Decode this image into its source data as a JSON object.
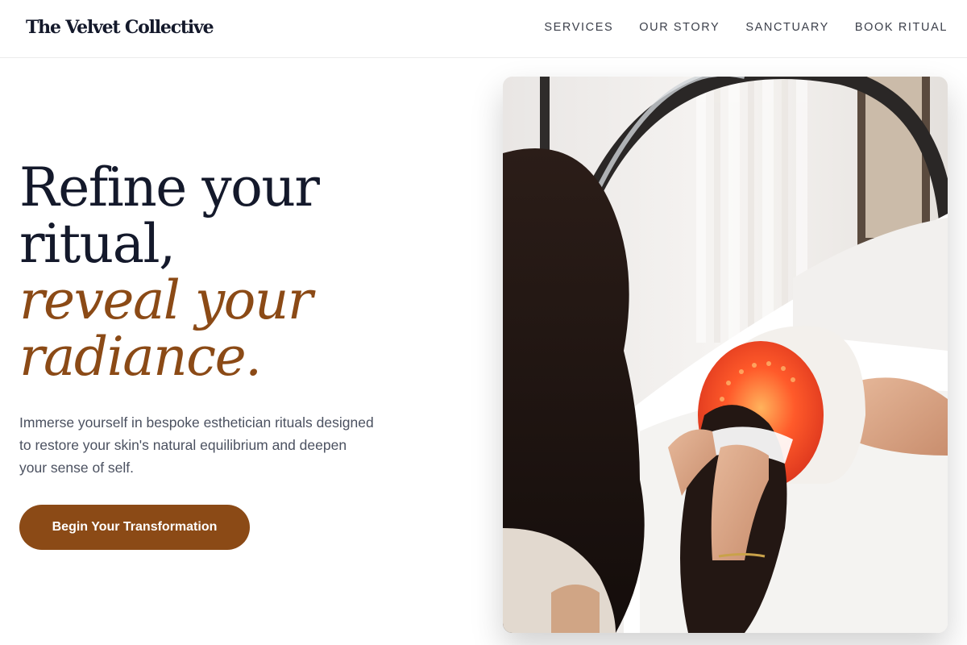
{
  "header": {
    "logo": "The Velvet Collective",
    "nav": [
      "SERVICES",
      "OUR STORY",
      "SANCTUARY",
      "BOOK RITUAL"
    ]
  },
  "hero": {
    "headline_line1": "Refine your",
    "headline_line2": "ritual,",
    "headline_line3": "reveal your",
    "headline_line4": "radiance.",
    "lede": "Immerse yourself in bespoke esthetician rituals designed to restore your skin's natural equilibrium and deepen your sense of self.",
    "cta_label": "Begin Your Transformation"
  },
  "colors": {
    "ink": "#14192b",
    "accent": "#8b4a16",
    "body_text": "#4b5160"
  }
}
